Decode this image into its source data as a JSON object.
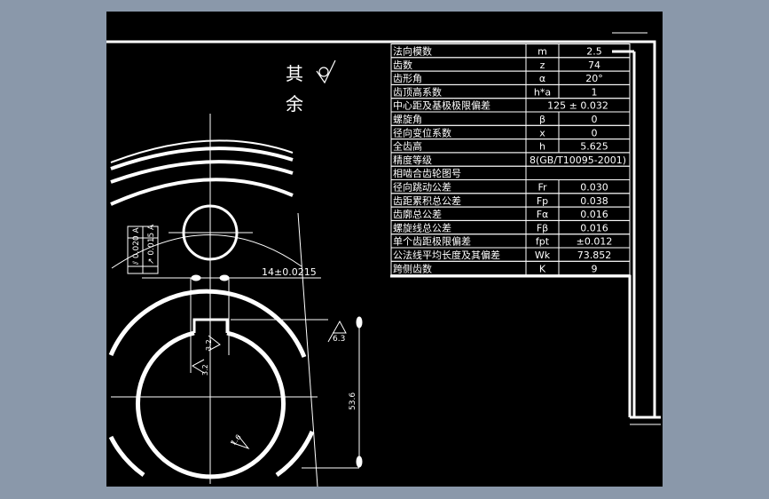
{
  "colors": {
    "background": "#8a98aa",
    "drawing_area": "#000000",
    "lines": "#ffffff"
  },
  "roughness_note": {
    "label": "其余",
    "symbol": "surface-finish-icon"
  },
  "table": {
    "rows": [
      {
        "name": "法向模数",
        "symbol": "m",
        "value": "2.5"
      },
      {
        "name": "齿数",
        "symbol": "z",
        "value": "74"
      },
      {
        "name": "齿形角",
        "symbol": "α",
        "value": "20°"
      },
      {
        "name": "齿顶高系数",
        "symbol": "h*a",
        "value": "1"
      },
      {
        "name": "中心距及基极极限偏差",
        "symbol": "",
        "value": "125 ± 0.032"
      },
      {
        "name": "螺旋角",
        "symbol": "β",
        "value": "0"
      },
      {
        "name": "径向变位系数",
        "symbol": "x",
        "value": "0"
      },
      {
        "name": "全齿高",
        "symbol": "h",
        "value": "5.625"
      },
      {
        "name": "精度等级",
        "symbol": "",
        "value": "8(GB/T10095-2001)"
      },
      {
        "name": "相啮合齿轮图号",
        "symbol": "",
        "value": ""
      },
      {
        "name": "径向跳动公差",
        "symbol": "Fr",
        "value": "0.030"
      },
      {
        "name": "齿距累积总公差",
        "symbol": "Fp",
        "value": "0.038"
      },
      {
        "name": "齿廓总公差",
        "symbol": "Fα",
        "value": "0.016"
      },
      {
        "name": "螺旋线总公差",
        "symbol": "Fβ",
        "value": "0.016"
      },
      {
        "name": "单个齿距极限偏差",
        "symbol": "fpt",
        "value": "±0.012"
      },
      {
        "name": "公法线平均长度及其偏差",
        "symbol": "Wk",
        "value": "73.852"
      },
      {
        "name": "跨侧齿数",
        "symbol": "K",
        "value": "9"
      }
    ]
  },
  "annotations": {
    "keyway_width": "14±0.0215",
    "tolerance_frame_1": [
      "⫽",
      "0.020",
      "A"
    ],
    "tolerance_frame_2": [
      "↗",
      "0.015",
      "A"
    ],
    "roughness_top": "6.3",
    "roughness_key_1": "3.2",
    "roughness_key_2": "3.2",
    "roughness_bore": "1.6",
    "bore_dim": "53.6"
  }
}
